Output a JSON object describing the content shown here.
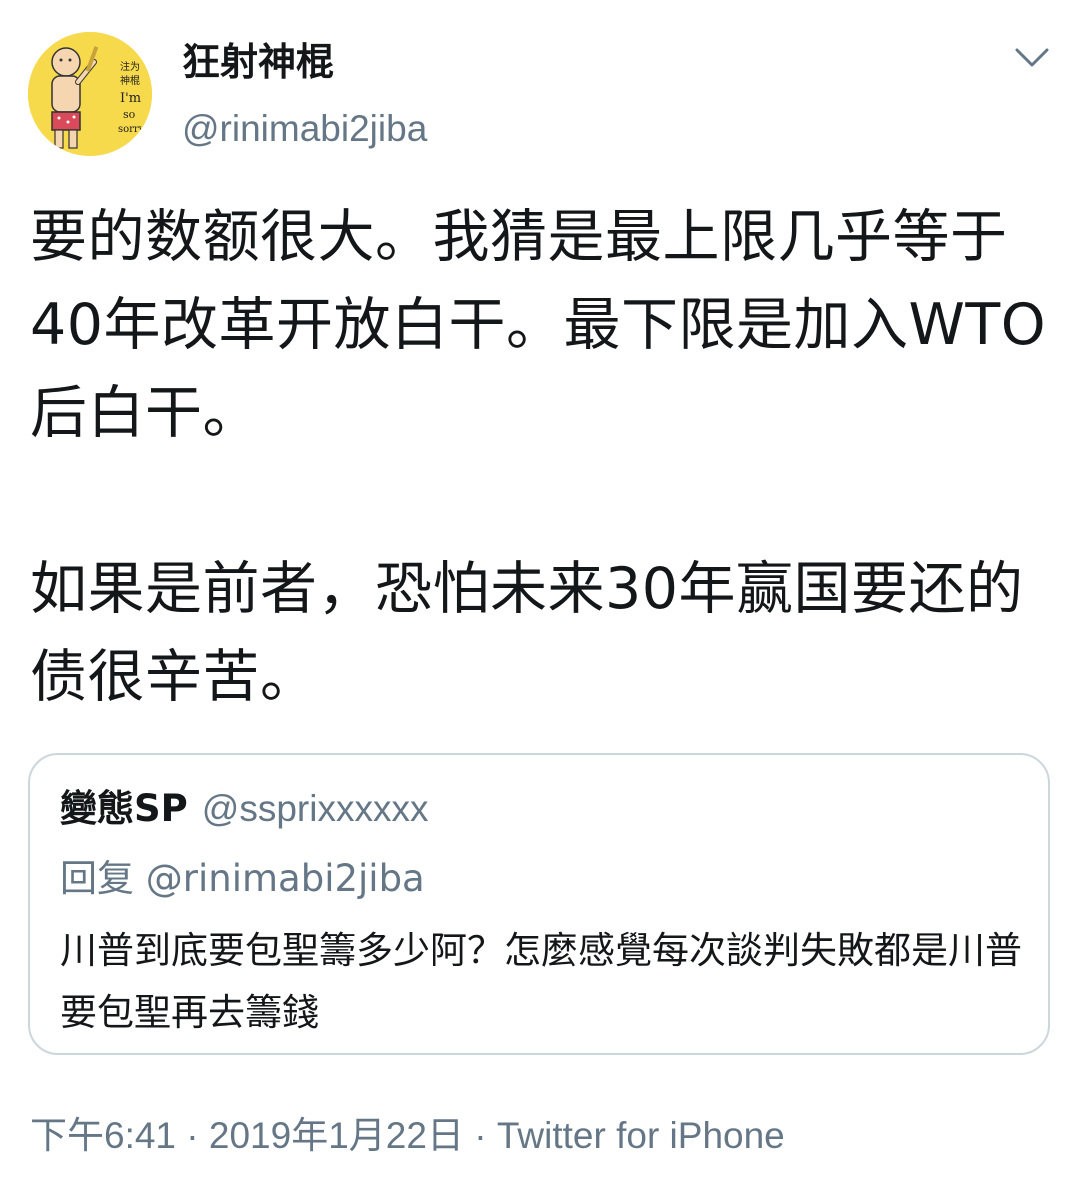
{
  "tweet": {
    "author": {
      "display_name": "狂射神棍",
      "handle": "@rinimabi2jiba",
      "avatar_text": [
        "注为",
        "神棍",
        "I'm",
        "so",
        "sorry"
      ]
    },
    "text": "要的数额很大。我猜是最上限几乎等于40年改革开放白干。最下限是加入WTO后白干。\n\n如果是前者，恐怕未来30年赢国要还的债很辛苦。",
    "menu_icon": "chevron-down-icon",
    "quoted": {
      "display_name": "變態SP",
      "handle": "@ssprixxxxxx",
      "reply_prefix": "回复",
      "reply_to": "@rinimabi2jiba",
      "text": "川普到底要包聖籌多少阿？怎麼感覺每次談判失敗都是川普要包聖再去籌錢"
    },
    "meta": {
      "time": "下午6:41",
      "separator": "·",
      "date": "2019年1月22日",
      "source": "Twitter for iPhone"
    }
  },
  "colors": {
    "text_primary": "#14171a",
    "text_secondary": "#657786",
    "border": "#ccd6dd",
    "avatar_bg": "#f7d94c"
  }
}
